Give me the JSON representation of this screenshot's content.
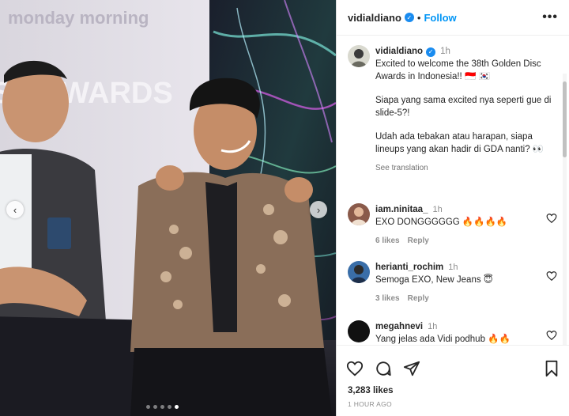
{
  "post": {
    "username": "vidialdiano",
    "follow_label": "Follow",
    "more_label": "•••",
    "carousel": {
      "slide_count": 5,
      "current_slide": 5
    }
  },
  "backdrop": {
    "sponsor_text": "monday morning",
    "banner_text": "SC AWARDS"
  },
  "caption": {
    "username": "vidialdiano",
    "time": "1h",
    "lines": [
      "Excited to welcome the 38th Golden Disc Awards in Indonesia!! 🇮🇩 🇰🇷",
      "Siapa yang sama excited nya seperti gue di slide-5?!",
      "Udah ada tebakan atau harapan, siapa lineups yang akan hadir di GDA nanti? 👀"
    ],
    "see_translation": "See translation"
  },
  "comments": [
    {
      "username": "iam.ninitaa_",
      "time": "1h",
      "text": "EXO DONGGGGGG 🔥🔥🔥🔥",
      "likes": "6 likes",
      "reply": "Reply",
      "avatar_color": "#8a5a4a"
    },
    {
      "username": "herianti_rochim",
      "time": "1h",
      "text": "Semoga EXO, New Jeans 😇",
      "likes": "3 likes",
      "reply": "Reply",
      "avatar_color": "#3a6ea8"
    },
    {
      "username": "megahnevi",
      "time": "1h",
      "text": "Yang jelas ada Vidi podhub 🔥🔥",
      "likes": "",
      "reply": "",
      "avatar_color": "#111111"
    }
  ],
  "actions": {
    "likes": "3,283 likes",
    "posted": "1 HOUR AGO"
  },
  "colors": {
    "accent": "#0095f6",
    "verified": "#1a8cf0"
  }
}
